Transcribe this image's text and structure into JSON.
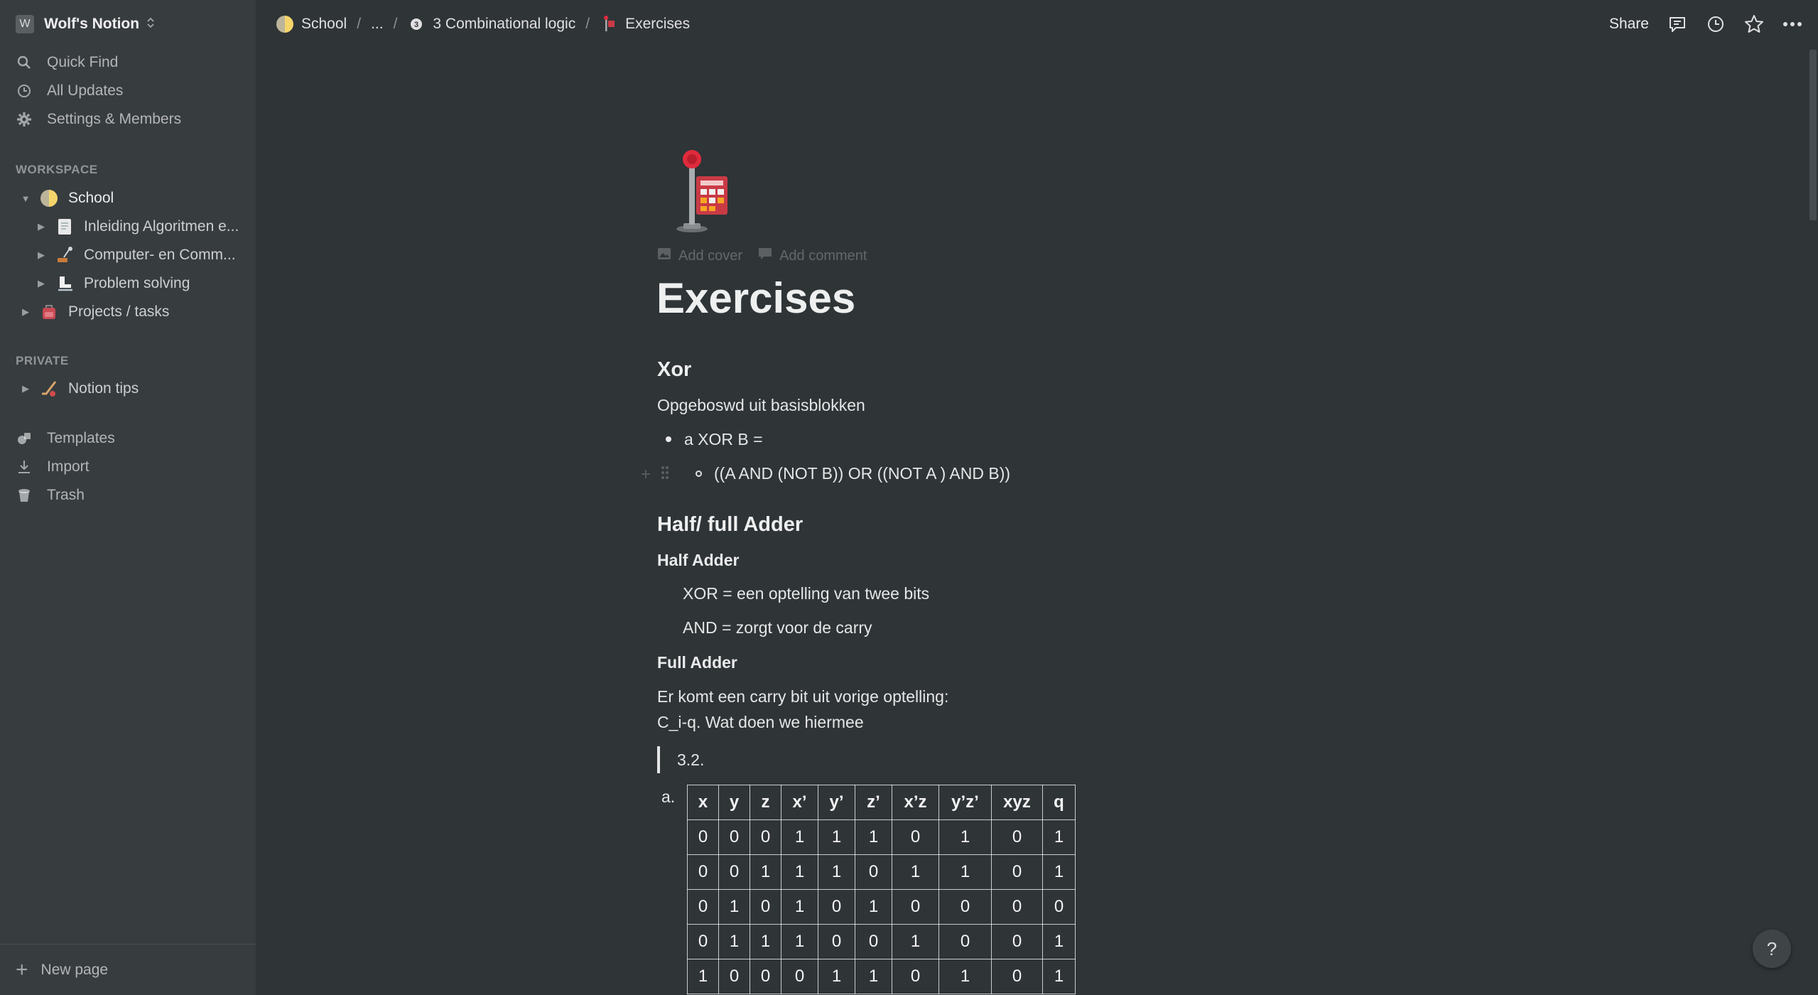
{
  "workspace": {
    "logo_letter": "W",
    "name": "Wolf's Notion"
  },
  "sidebar": {
    "top_items": [
      {
        "label": "Quick Find",
        "icon": "search-icon"
      },
      {
        "label": "All Updates",
        "icon": "clock-icon"
      },
      {
        "label": "Settings & Members",
        "icon": "gear-icon"
      }
    ],
    "workspace_section": "WORKSPACE",
    "tree": [
      {
        "label": "School",
        "icon": "half-moon-icon",
        "expanded": true
      },
      {
        "label": "Inleiding Algoritmen e...",
        "icon": "page-icon"
      },
      {
        "label": "Computer- en Comm...",
        "icon": "satellite-icon"
      },
      {
        "label": "Problem solving",
        "icon": "ice-skate-icon"
      },
      {
        "label": "Projects / tasks",
        "icon": "school-bag-icon"
      }
    ],
    "private_section": "PRIVATE",
    "private_tree": [
      {
        "label": "Notion tips",
        "icon": "hockey-icon"
      }
    ],
    "bottom_items": [
      {
        "label": "Templates",
        "icon": "templates-icon"
      },
      {
        "label": "Import",
        "icon": "import-icon"
      },
      {
        "label": "Trash",
        "icon": "trash-icon"
      }
    ],
    "new_page": "New page"
  },
  "breadcrumb": {
    "items": [
      "School",
      "...",
      "3 Combinational logic",
      "Exercises"
    ]
  },
  "topbar": {
    "share": "Share"
  },
  "page": {
    "add_cover": "Add cover",
    "add_comment": "Add comment",
    "title": "Exercises",
    "xor_heading": "Xor",
    "xor_para": "Opgeboswd uit basisblokken",
    "xor_bullet": "a XOR B =",
    "xor_sub_bullet": "((A AND (NOT B)) OR ((NOT A ) AND B))",
    "adder_heading": "Half/ full Adder",
    "half_adder_heading": "Half Adder",
    "half_adder_line1": "XOR = een optelling van twee bits",
    "half_adder_line2": "AND = zorgt voor de carry",
    "full_adder_heading": "Full Adder",
    "full_adder_line1": "Er komt een carry bit uit vorige optelling:",
    "full_adder_line2": "C_i-q. Wat doen we hiermee",
    "quote": "3.2.",
    "list_marker": "a."
  },
  "truth_table": {
    "headers": [
      "x",
      "y",
      "z",
      "x’",
      "y’",
      "z’",
      "x’z",
      "y’z’",
      "xyz",
      "q"
    ],
    "rows": [
      [
        "0",
        "0",
        "0",
        "1",
        "1",
        "1",
        "0",
        "1",
        "0",
        "1"
      ],
      [
        "0",
        "0",
        "1",
        "1",
        "1",
        "0",
        "1",
        "1",
        "0",
        "1"
      ],
      [
        "0",
        "1",
        "0",
        "1",
        "0",
        "1",
        "0",
        "0",
        "0",
        "0"
      ],
      [
        "0",
        "1",
        "1",
        "1",
        "0",
        "0",
        "1",
        "0",
        "0",
        "1"
      ],
      [
        "1",
        "0",
        "0",
        "0",
        "1",
        "1",
        "0",
        "1",
        "0",
        "1"
      ]
    ]
  },
  "help": "?"
}
